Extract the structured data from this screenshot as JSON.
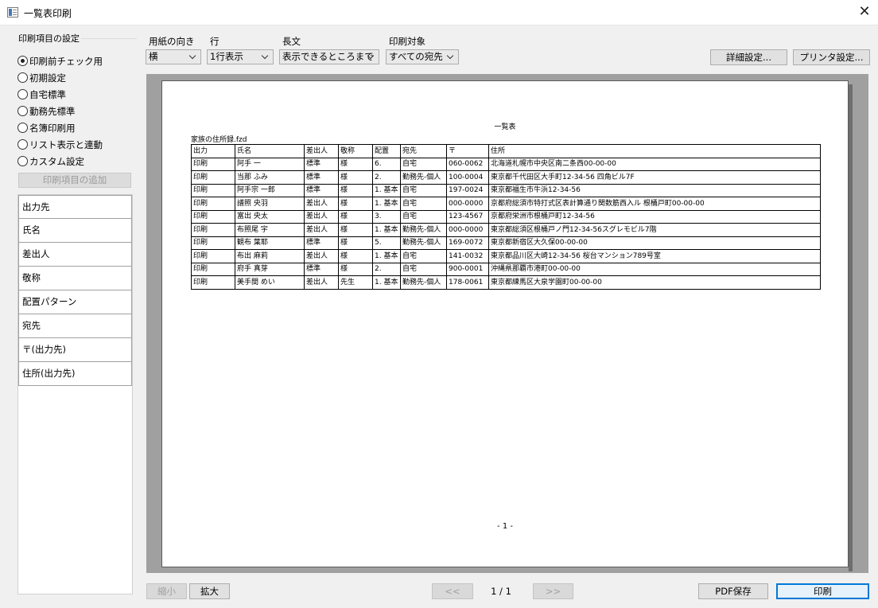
{
  "window": {
    "title": "一覧表印刷",
    "close_glyph": "✕"
  },
  "settings_group": {
    "title": "印刷項目の設定",
    "radios": [
      {
        "label": "印刷前チェック用",
        "selected": true
      },
      {
        "label": "初期設定",
        "selected": false
      },
      {
        "label": "自宅標準",
        "selected": false
      },
      {
        "label": "勤務先標準",
        "selected": false
      },
      {
        "label": "名簿印刷用",
        "selected": false
      },
      {
        "label": "リスト表示と連動",
        "selected": false
      },
      {
        "label": "カスタム設定",
        "selected": false
      }
    ],
    "add_button": "印刷項目の追加",
    "items": [
      "出力先",
      "氏名",
      "差出人",
      "敬称",
      "配置パターン",
      "宛先",
      "〒(出力先)",
      "住所(出力先)"
    ]
  },
  "options": {
    "paper": {
      "label": "用紙の向き",
      "value": "横"
    },
    "rows": {
      "label": "行",
      "value": "1行表示"
    },
    "long_text": {
      "label": "長文",
      "value": "表示できるところまで"
    },
    "target": {
      "label": "印刷対象",
      "value": "すべての宛先"
    }
  },
  "buttons": {
    "detail": "詳細設定...",
    "printer": "プリンタ設定...",
    "zoom_out": "縮小",
    "zoom_in": "拡大",
    "prev": "<<",
    "next": ">>",
    "pdf": "PDF保存",
    "print": "印刷"
  },
  "pager": {
    "text": "1 / 1"
  },
  "document": {
    "title": "一覧表",
    "file_name": "家族の住所録.fzd",
    "page_label": "- 1 -",
    "headers": [
      "出力",
      "氏名",
      "差出人",
      "敬称",
      "配置",
      "宛先",
      "〒",
      "住所"
    ],
    "rows": [
      [
        "印刷",
        "阿手 一",
        "標準",
        "様",
        "6.",
        "自宅",
        "060-0062",
        "北海道札幌市中央区南二条西00-00-00"
      ],
      [
        "印刷",
        "当那 ふみ",
        "標準",
        "様",
        "2.",
        "勤務先-個人",
        "100-0004",
        "東京都千代田区大手町12-34-56 四角ビル7F"
      ],
      [
        "印刷",
        "阿手宗 一郎",
        "標準",
        "様",
        "1. 基本",
        "自宅",
        "197-0024",
        "東京都福生市牛浜12-34-56"
      ],
      [
        "印刷",
        "譜照 央羽",
        "差出人",
        "様",
        "1. 基本",
        "自宅",
        "000-0000",
        "京都府総須市特打式区表計算通り関数筋西入ル 根桶戸町00-00-00"
      ],
      [
        "印刷",
        "富出 央太",
        "差出人",
        "様",
        "3.",
        "自宅",
        "123-4567",
        "京都府栄洲市根桶戸町12-34-56"
      ],
      [
        "印刷",
        "布照尾 宇",
        "差出人",
        "様",
        "1. 基本",
        "勤務先-個人",
        "000-0000",
        "東京都総須区根桶戸ノ門12-34-56スグレモビル7階"
      ],
      [
        "印刷",
        "観布 葉耶",
        "標準",
        "様",
        "5.",
        "勤務先-個人",
        "169-0072",
        "東京都新宿区大久保00-00-00"
      ],
      [
        "印刷",
        "布出 麻莉",
        "差出人",
        "様",
        "1. 基本",
        "自宅",
        "141-0032",
        "東京都品川区大崎12-34-56 桜台マンション789号室"
      ],
      [
        "印刷",
        "府手 真芽",
        "標準",
        "様",
        "2.",
        "自宅",
        "900-0001",
        "沖縄県那覇市港町00-00-00"
      ],
      [
        "印刷",
        "美手間 めい",
        "差出人",
        "先生",
        "1. 基本",
        "勤務先-個人",
        "178-0061",
        "東京都練馬区大泉学園町00-00-00"
      ]
    ]
  }
}
